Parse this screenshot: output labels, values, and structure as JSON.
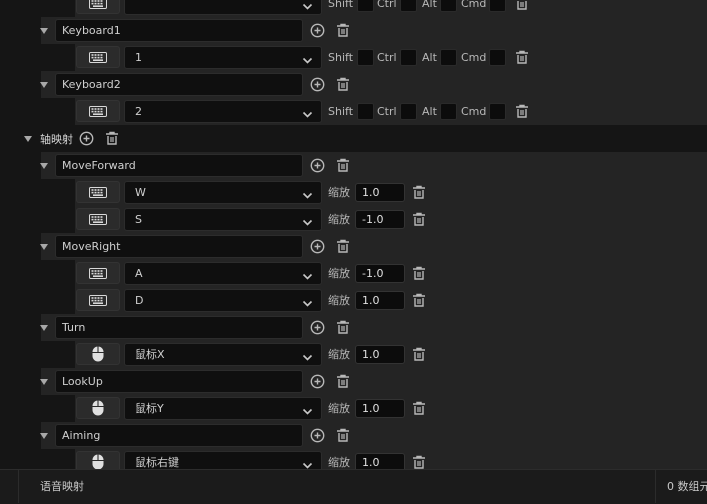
{
  "action_mappings": {
    "truncated_top_row": {
      "modifiers": [
        "Shift",
        "Ctrl",
        "Alt",
        "Cmd"
      ]
    },
    "items": [
      {
        "name": "Keyboard1",
        "key": "1",
        "modifiers": [
          "Shift",
          "Ctrl",
          "Alt",
          "Cmd"
        ]
      },
      {
        "name": "Keyboard2",
        "key": "2",
        "modifiers": [
          "Shift",
          "Ctrl",
          "Alt",
          "Cmd"
        ]
      }
    ]
  },
  "axis_section": {
    "label": "轴映射"
  },
  "axis_mappings": [
    {
      "name": "MoveForward",
      "bindings": [
        {
          "device": "keyboard-icon",
          "key": "W",
          "scale_label": "缩放",
          "scale": "1.0"
        },
        {
          "device": "keyboard-icon",
          "key": "S",
          "scale_label": "缩放",
          "scale": "-1.0"
        }
      ]
    },
    {
      "name": "MoveRight",
      "bindings": [
        {
          "device": "keyboard-icon",
          "key": "A",
          "scale_label": "缩放",
          "scale": "-1.0"
        },
        {
          "device": "keyboard-icon",
          "key": "D",
          "scale_label": "缩放",
          "scale": "1.0"
        }
      ]
    },
    {
      "name": "Turn",
      "bindings": [
        {
          "device": "mouse-icon",
          "key": "鼠标X",
          "scale_label": "缩放",
          "scale": "1.0"
        }
      ]
    },
    {
      "name": "LookUp",
      "bindings": [
        {
          "device": "mouse-icon",
          "key": "鼠标Y",
          "scale_label": "缩放",
          "scale": "1.0"
        }
      ]
    },
    {
      "name": "Aiming",
      "bindings": [
        {
          "device": "mouse-icon",
          "key": "鼠标右键",
          "scale_label": "缩放",
          "scale": "1.0"
        }
      ]
    }
  ],
  "footer": {
    "left_label": "语音映射",
    "right_label": "0 数组元"
  },
  "colors": {
    "background": "#151515",
    "row": "#242424",
    "field": "#0f0f0f",
    "text": "#c0c0c0"
  }
}
